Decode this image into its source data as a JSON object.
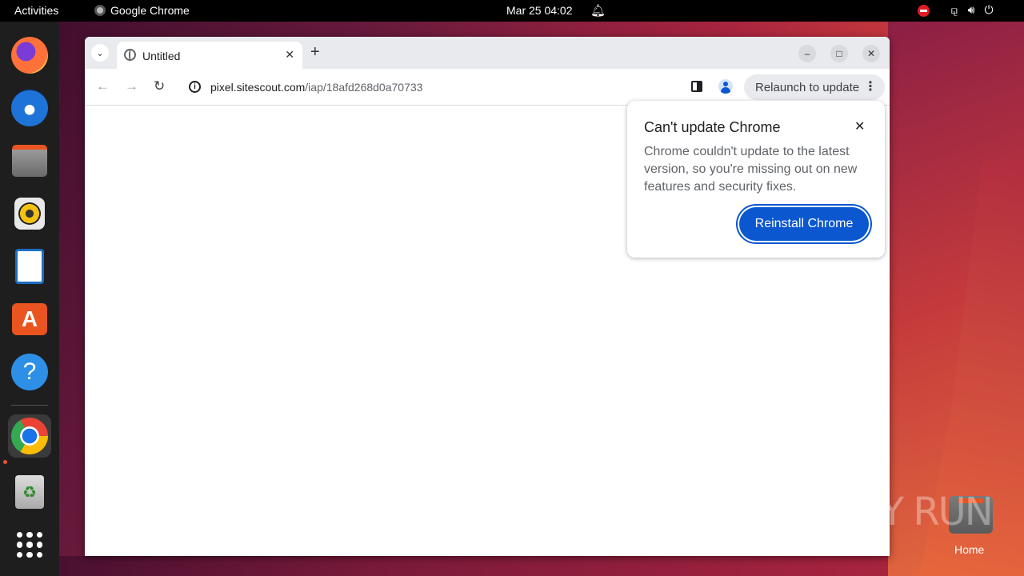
{
  "topbar": {
    "activities": "Activities",
    "app_name": "Google Chrome",
    "clock": "Mar 25  04:02"
  },
  "dock": {
    "apps": [
      "firefox",
      "thunderbird",
      "files",
      "rhythmbox",
      "libreoffice-writer",
      "app-center",
      "help",
      "google-chrome",
      "trash",
      "show-apps"
    ],
    "running": "google-chrome"
  },
  "browser": {
    "tab_title": "Untitled",
    "url_host": "pixel.sitescout.com",
    "url_path": "/iap/18afd268d0a70733",
    "relaunch_label": "Relaunch to update"
  },
  "popup": {
    "title": "Can't update Chrome",
    "body": "Chrome couldn't update to the latest version, so you're missing out on new features and security fixes.",
    "button": "Reinstall Chrome"
  },
  "desktop": {
    "watermark": "ANY RUN",
    "home_label": "Home"
  }
}
